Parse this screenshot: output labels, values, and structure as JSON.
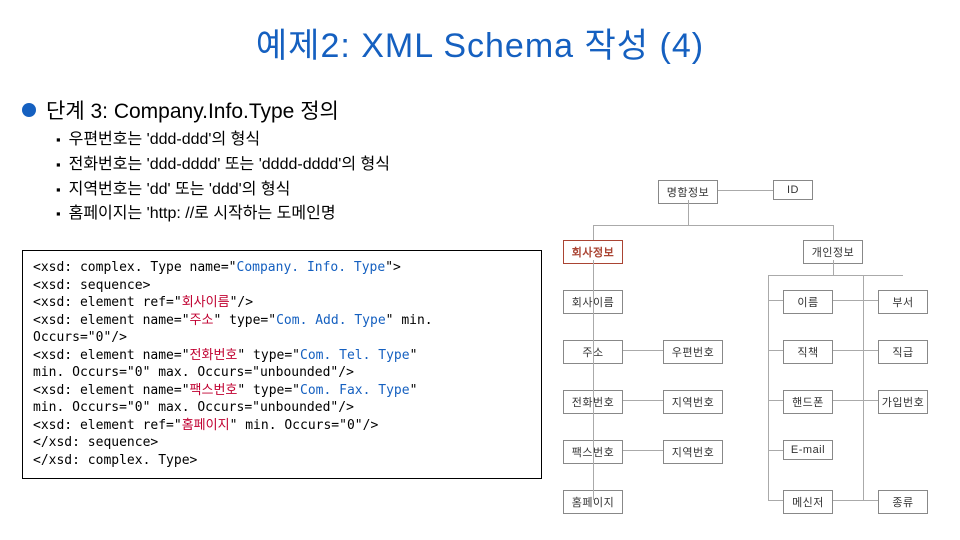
{
  "title": "예제2: XML Schema 작성 (4)",
  "section": "단계 3: Company.Info.Type 정의",
  "bullets": [
    "우편번호는 'ddd-ddd'의 형식",
    "전화번호는 'ddd-dddd' 또는 'dddd-dddd'의 형식",
    "지역번호는 'dd' 또는 'ddd'의 형식",
    "홈페이지는 'http: //로 시작하는 도메인명"
  ],
  "code": {
    "l1a": "<xsd: complex. Type name=\"",
    "l1b": "Company. Info. Type",
    "l1c": "\">",
    "l2": " <xsd: sequence>",
    "l3a": "  <xsd: element ref=\"",
    "l3b": "회사이름",
    "l3c": "\"/>",
    "l4a": "  <xsd: element name=\"",
    "l4b": "주소",
    "l4c": "\" type=\"",
    "l4d": "Com. Add. Type",
    "l4e": "\" min. Occurs=\"0\"/>",
    "l5a": "  <xsd: element name=\"",
    "l5b": "전화번호",
    "l5c": "\" type=\"",
    "l5d": "Com. Tel. Type",
    "l5e": "\"",
    "l6": "min. Occurs=\"0\" max. Occurs=\"unbounded\"/>",
    "l7a": "  <xsd: element name=\"",
    "l7b": "팩스번호",
    "l7c": "\" type=\"",
    "l7d": "Com. Fax. Type",
    "l7e": "\"",
    "l8": "min. Occurs=\"0\" max. Occurs=\"unbounded\"/>",
    "l9a": "  <xsd: element ref=\"",
    "l9b": "홈페이지",
    "l9c": "\" min. Occurs=\"0\"/>",
    "l10": " </xsd: sequence>",
    "l11": "</xsd: complex. Type>"
  },
  "diagram": {
    "n_top": "명함정보",
    "n_id": "ID",
    "n_company": "회사정보",
    "n_personal": "개인정보",
    "n_cname": "회사이름",
    "n_addr": "주소",
    "n_tel": "전화번호",
    "n_fax": "팩스번호",
    "n_home": "홈페이지",
    "n_zip": "우편번호",
    "n_area1": "지역번호",
    "n_area2": "지역번호",
    "n_pname": "이름",
    "n_title": "직책",
    "n_hp": "핸드폰",
    "n_email": "E-mail",
    "n_msg": "메신저",
    "n_dept": "부서",
    "n_grade": "직급",
    "n_join": "가입번호",
    "n_kind": "종류"
  }
}
